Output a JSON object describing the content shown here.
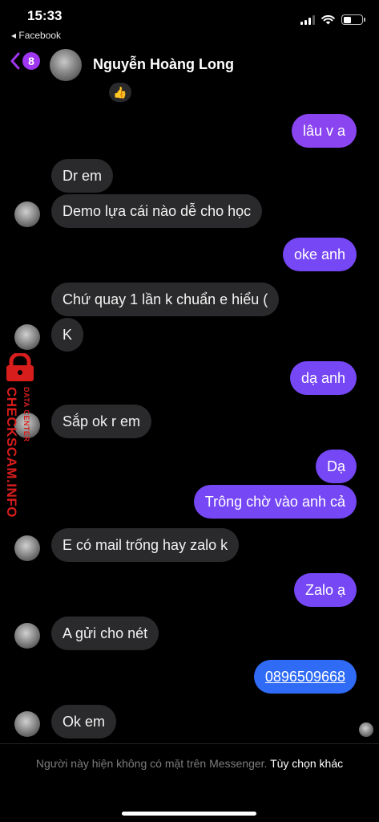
{
  "status_bar": {
    "time": "15:33",
    "back_app": "◂ Facebook"
  },
  "header": {
    "unread_count": "8",
    "name": "Nguyễn Hoàng Long"
  },
  "reaction": "👍",
  "messages": [
    {
      "text": "lâu v a"
    },
    {
      "text": "Dr em"
    },
    {
      "text": "Demo lựa cái nào dễ cho học"
    },
    {
      "text": "oke anh"
    },
    {
      "text": "Chứ quay 1 lần k chuẩn e hiểu ("
    },
    {
      "text": "K"
    },
    {
      "text": "dạ anh"
    },
    {
      "text": "Sắp ok r em"
    },
    {
      "text": "Dạ"
    },
    {
      "text": "Trông chờ vào anh cả"
    },
    {
      "text": "E có mail trống hay zalo k"
    },
    {
      "text": "Zalo ạ"
    },
    {
      "text": "A gửi cho nét"
    },
    {
      "text": "0896509668"
    },
    {
      "text": "Ok em"
    }
  ],
  "watermark": {
    "brand": "CHECKSCAM.INFO",
    "sub": "DATA CENTER"
  },
  "footer": {
    "notice": "Người này hiện không có mặt trên Messenger.",
    "action": "Tùy chọn khác"
  },
  "colors": {
    "outgoing": "#7647f5",
    "outgoing_blue": "#2f6bf5",
    "incoming": "#2a2a2c",
    "badge": "#9f36f0",
    "watermark": "#d81d1d"
  }
}
